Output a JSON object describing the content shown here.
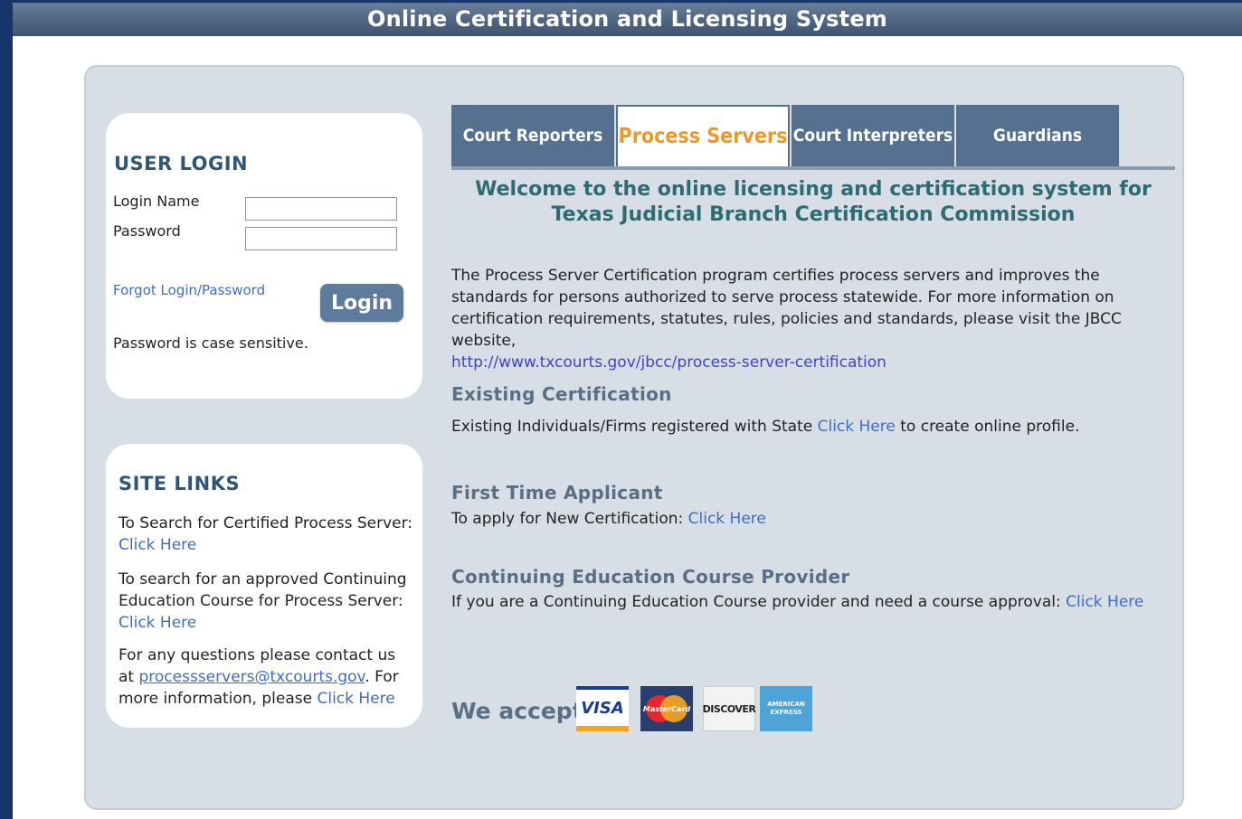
{
  "header": {
    "title": "Online Certification and Licensing System"
  },
  "login": {
    "heading": "USER LOGIN",
    "login_name_label": "Login Name",
    "password_label": "Password",
    "login_name_value": "",
    "password_value": "",
    "forgot_link": "Forgot Login/Password",
    "login_button": "Login",
    "note": "Password is case sensitive."
  },
  "site_links": {
    "heading": "SITE LINKS",
    "search_server_text": "To Search for Certified Process Server: ",
    "search_server_link": "Click Here",
    "search_course_text": "To search for an approved Continuing Education Course for Process Server: ",
    "search_course_link": "Click Here",
    "contact_text_1": "For any questions please contact us at ",
    "contact_email": "processservers@txcourts.gov",
    "contact_text_2": ". For more information, please ",
    "contact_link": "Click Here"
  },
  "tabs": [
    {
      "label": "Court Reporters",
      "active": false
    },
    {
      "label": "Process Servers",
      "active": true
    },
    {
      "label": "Court Interpreters",
      "active": false
    },
    {
      "label": "Guardians",
      "active": false
    }
  ],
  "main": {
    "welcome": "Welcome to the online licensing and certification system for Texas Judicial Branch Certification Commission",
    "intro": "The Process Server Certification program certifies process servers and improves the standards for persons authorized to serve process statewide. For more information on certification requirements, statutes, rules, policies and standards, please visit the JBCC website,",
    "intro_url": "http://www.txcourts.gov/jbcc/process-server-certification",
    "existing": {
      "heading": "Existing Certification",
      "text_before": "Existing Individuals/Firms registered with State ",
      "link": "Click Here",
      "text_after": " to create online profile."
    },
    "first_time": {
      "heading": "First Time Applicant",
      "text": "To apply for New Certification: ",
      "link": "Click Here"
    },
    "ce_provider": {
      "heading": "Continuing Education Course Provider",
      "text": "If you are a Continuing Education Course provider and need a course approval: ",
      "link": "Click Here"
    },
    "accept_label": "We accept:",
    "cards": {
      "visa": "VISA",
      "mastercard": "MasterCard",
      "discover": "DISCOVER",
      "amex": "AMERICAN EXPRESS"
    }
  },
  "colors": {
    "header": "#4e6480",
    "tab_bg": "#56708f",
    "tab_active_text": "#e79b2a",
    "link": "#3e6ec1",
    "welcome_text": "#2f6b73",
    "panel_bg": "#d8dee6"
  }
}
